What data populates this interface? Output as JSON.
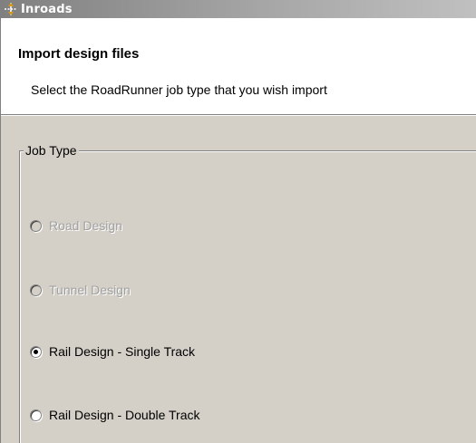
{
  "window": {
    "title": "Inroads",
    "icon": "inroads-app-icon"
  },
  "header": {
    "heading": "Import design files",
    "subheading": "Select the RoadRunner job type that you wish import"
  },
  "job_type": {
    "label": "Job Type",
    "options": [
      {
        "label": "Road Design",
        "selected": false,
        "enabled": false
      },
      {
        "label": "Tunnel Design",
        "selected": false,
        "enabled": false
      },
      {
        "label": "Rail Design - Single Track",
        "selected": true,
        "enabled": true
      },
      {
        "label": "Rail Design - Double Track",
        "selected": false,
        "enabled": true
      }
    ]
  },
  "colors": {
    "dialog_bg": "#d4d0c8",
    "disabled_text": "#a0a0a0",
    "icon_accent": "#d99a1a"
  }
}
